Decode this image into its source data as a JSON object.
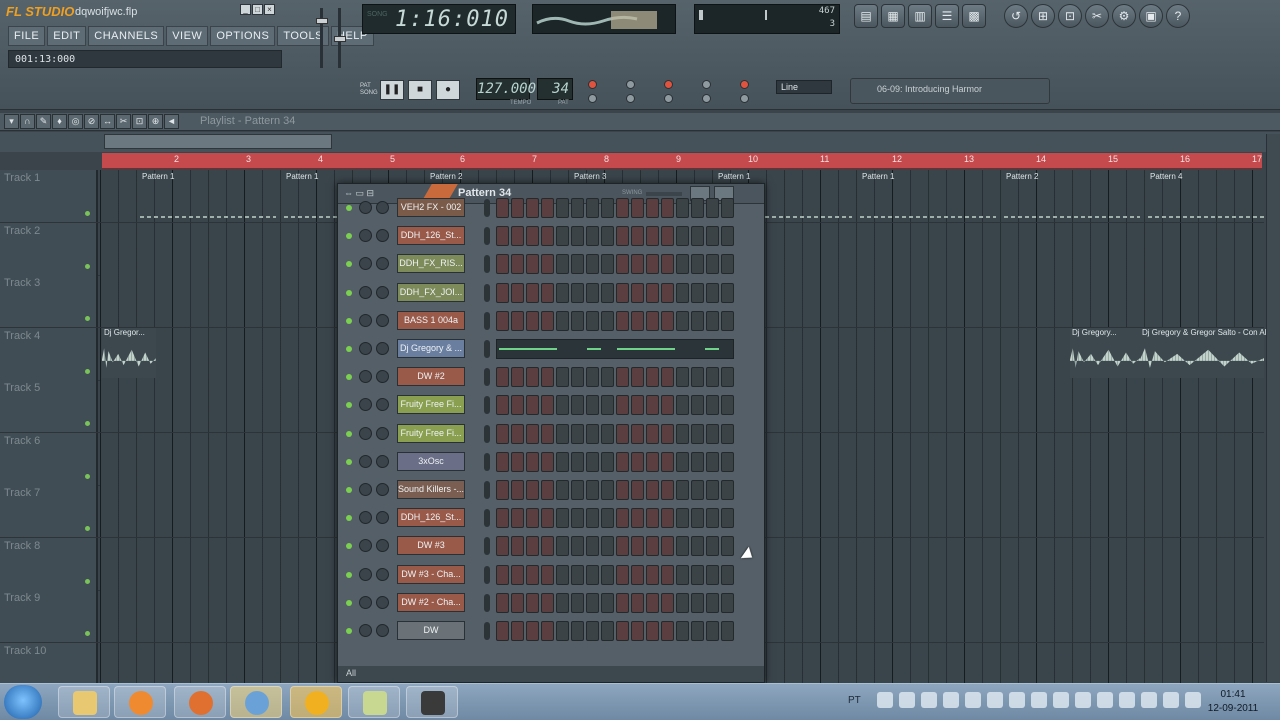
{
  "app": {
    "logo": "FL STUDIO",
    "project_file": "dqwoifjwc.flp",
    "hint_bar": "001:13:000",
    "time_display": "1:16:010",
    "cpu_value": "467",
    "poly_value": "3",
    "tempo": "127.000",
    "tempo_label": "TEMPO",
    "pattern_number": "34",
    "pattern_label": "PAT",
    "snap": "Line",
    "hint_panel": "06-09: Introducing Harmor"
  },
  "menu": [
    "FILE",
    "EDIT",
    "CHANNELS",
    "VIEW",
    "OPTIONS",
    "TOOLS",
    "HELP"
  ],
  "playlist": {
    "title": "Playlist - Pattern 34",
    "ruler": [
      "2",
      "3",
      "4",
      "5",
      "6",
      "7",
      "8",
      "9",
      "10",
      "11",
      "12",
      "13",
      "14",
      "15",
      "16",
      "17"
    ],
    "tracks": [
      "Track 1",
      "Track 2",
      "Track 3",
      "Track 4",
      "Track 5",
      "Track 6",
      "Track 7",
      "Track 8",
      "Track 9",
      "Track 10"
    ],
    "pattern_clips": [
      "Pattern 1",
      "Pattern 1",
      "Pattern 2",
      "Pattern 3",
      "Pattern 1",
      "Pattern 1",
      "Pattern 2",
      "Pattern 4"
    ],
    "audio_clips": [
      "Dj Gregor...",
      "Dj Gregory...",
      "Dj Gregory & Gregor Salto - Con Alec"
    ]
  },
  "sequencer": {
    "title": "Pattern 34",
    "swing_label": "SWING",
    "filter": "All",
    "channels": [
      {
        "name": "VEH2 FX - 002",
        "color": "#7a5a48"
      },
      {
        "name": "DDH_126_St...",
        "color": "#9a5a4a"
      },
      {
        "name": "DDH_FX_RIS...",
        "color": "#7d8a5a"
      },
      {
        "name": "DDH_FX_JOI...",
        "color": "#7d8a5a"
      },
      {
        "name": "BASS 1 004a",
        "color": "#9a5a4a"
      },
      {
        "name": "Dj Gregory & ...",
        "color": "#6a7ea0"
      },
      {
        "name": "DW #2",
        "color": "#9a5a4a"
      },
      {
        "name": "Fruity Free Fi...",
        "color": "#8aa050"
      },
      {
        "name": "Fruity Free Fi...",
        "color": "#8aa050"
      },
      {
        "name": "3xOsc",
        "color": "#6a6e86"
      },
      {
        "name": "Sound Killers -...",
        "color": "#7a5e52"
      },
      {
        "name": "DDH_126_St...",
        "color": "#9a5a4a"
      },
      {
        "name": "DW #3",
        "color": "#9a5a4a"
      },
      {
        "name": "DW #3 - Cha...",
        "color": "#9a5a4a"
      },
      {
        "name": "DW #2 - Cha...",
        "color": "#9a5a4a"
      },
      {
        "name": "DW",
        "color": "#6a7278"
      }
    ]
  },
  "taskbar": {
    "language": "PT",
    "time": "01:41",
    "date": "12-09-2011"
  }
}
